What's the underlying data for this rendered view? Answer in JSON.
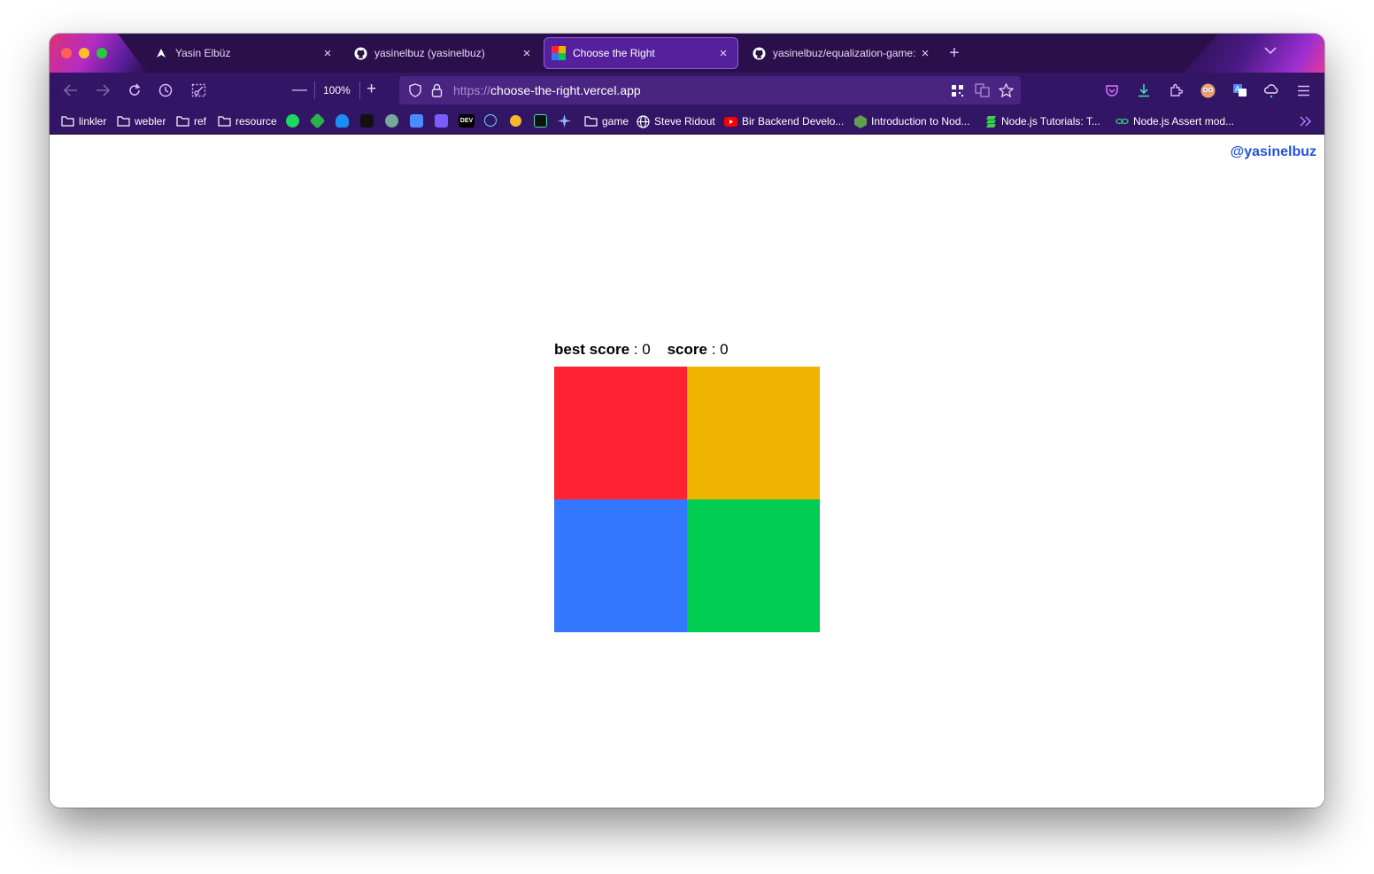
{
  "browser": {
    "tabs": [
      {
        "label": "Yasin Elbüz",
        "icon": "triangle-logo-icon",
        "active": false
      },
      {
        "label": "yasinelbuz (yasinelbuz)",
        "icon": "github-icon",
        "active": false
      },
      {
        "label": "Choose the Right",
        "icon": "four-colors-icon",
        "active": true
      },
      {
        "label": "yasinelbuz/equalization-game: ",
        "icon": "github-icon",
        "active": false
      }
    ],
    "new_tab_label": "+",
    "zoom_minus": "—",
    "zoom_level": "100%",
    "zoom_plus": "+",
    "url_protocol": "https://",
    "url_host": "choose-the-right.vercel.app"
  },
  "bookmarks": [
    {
      "label": "linkler",
      "icon": "folder-icon"
    },
    {
      "label": "webler",
      "icon": "folder-icon"
    },
    {
      "label": "ref",
      "icon": "folder-icon"
    },
    {
      "label": "resource",
      "icon": "folder-icon"
    },
    {
      "label": "game",
      "icon": "folder-icon"
    },
    {
      "label": "Steve Ridout",
      "icon": "globe-icon"
    },
    {
      "label": "Bir Backend Develo...",
      "icon": "youtube-icon"
    },
    {
      "label": "Introduction to Nod...",
      "icon": "nodejs-icon"
    },
    {
      "label": "Node.js Tutorials: T...",
      "icon": "stack-icon"
    },
    {
      "label": "Node.js Assert mod...",
      "icon": "link-icon"
    }
  ],
  "bookmark_icons": [
    "spotify-icon",
    "feedly-icon",
    "cloud-icon",
    "cursor-icon",
    "openai-icon",
    "translate-icon",
    "tools-icon",
    "dev-icon",
    "react-icon",
    "circle-icon",
    "activity-icon",
    "sparkle-icon"
  ],
  "page": {
    "author": "@yasinelbuz",
    "best_score_label": "best score",
    "best_score_value": "0",
    "score_label": "score",
    "score_value": "0",
    "colors": {
      "red": "#ff2232",
      "yellow": "#f0b400",
      "blue": "#3377ff",
      "green": "#00cc52"
    }
  }
}
